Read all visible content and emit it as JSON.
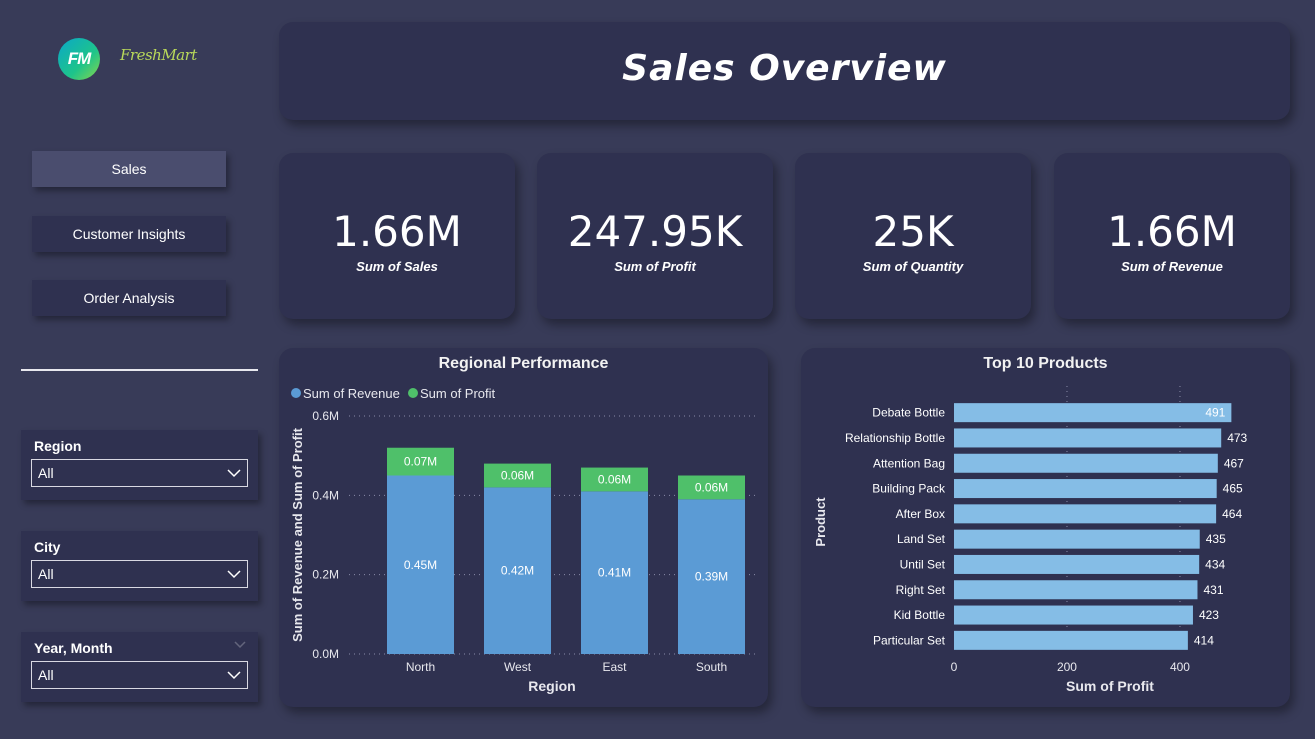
{
  "brand": {
    "logo_initials": "FM",
    "logo_script": "FreshMart"
  },
  "header": {
    "title": "Sales Overview"
  },
  "nav": [
    {
      "label": "Sales",
      "active": true
    },
    {
      "label": "Customer Insights",
      "active": false
    },
    {
      "label": "Order Analysis",
      "active": false
    }
  ],
  "slicers": [
    {
      "label": "Region",
      "value": "All"
    },
    {
      "label": "City",
      "value": "All"
    },
    {
      "label": "Year, Month",
      "value": "All"
    }
  ],
  "kpis": [
    {
      "value": "1.66M",
      "label": "Sum of Sales"
    },
    {
      "value": "247.95K",
      "label": "Sum of Profit"
    },
    {
      "value": "25K",
      "label": "Sum of Quantity"
    },
    {
      "value": "1.66M",
      "label": "Sum of Revenue"
    }
  ],
  "colors": {
    "revenue": "#5b9bd5",
    "profit": "#4fc06a",
    "product_bar": "#85bde6"
  },
  "chart_data": [
    {
      "type": "bar",
      "stacked": true,
      "title": "Regional Performance",
      "xlabel": "Region",
      "ylabel": "Sum of Revenue and Sum of Profit",
      "categories": [
        "North",
        "West",
        "East",
        "South"
      ],
      "series": [
        {
          "name": "Sum of Revenue",
          "values": [
            0.45,
            0.42,
            0.41,
            0.39
          ],
          "labels": [
            "0.45M",
            "0.42M",
            "0.41M",
            "0.39M"
          ]
        },
        {
          "name": "Sum of Profit",
          "values": [
            0.07,
            0.06,
            0.06,
            0.06
          ],
          "labels": [
            "0.07M",
            "0.06M",
            "0.06M",
            "0.06M"
          ]
        }
      ],
      "ylim": [
        0,
        0.6
      ],
      "yticks": [
        0,
        0.2,
        0.4,
        0.6
      ],
      "ytick_labels": [
        "0.0M",
        "0.2M",
        "0.4M",
        "0.6M"
      ],
      "legend": "top-left",
      "grid": true
    },
    {
      "type": "bar",
      "orientation": "horizontal",
      "title": "Top 10 Products",
      "xlabel": "Sum of Profit",
      "ylabel": "Product",
      "categories": [
        "Debate Bottle",
        "Relationship Bottle",
        "Attention Bag",
        "Building Pack",
        "After Box",
        "Land Set",
        "Until Set",
        "Right Set",
        "Kid Bottle",
        "Particular Set"
      ],
      "values": [
        491,
        473,
        467,
        465,
        464,
        435,
        434,
        431,
        423,
        414
      ],
      "xlim": [
        0,
        570
      ],
      "xticks": [
        0,
        200,
        400
      ],
      "grid": true
    }
  ]
}
